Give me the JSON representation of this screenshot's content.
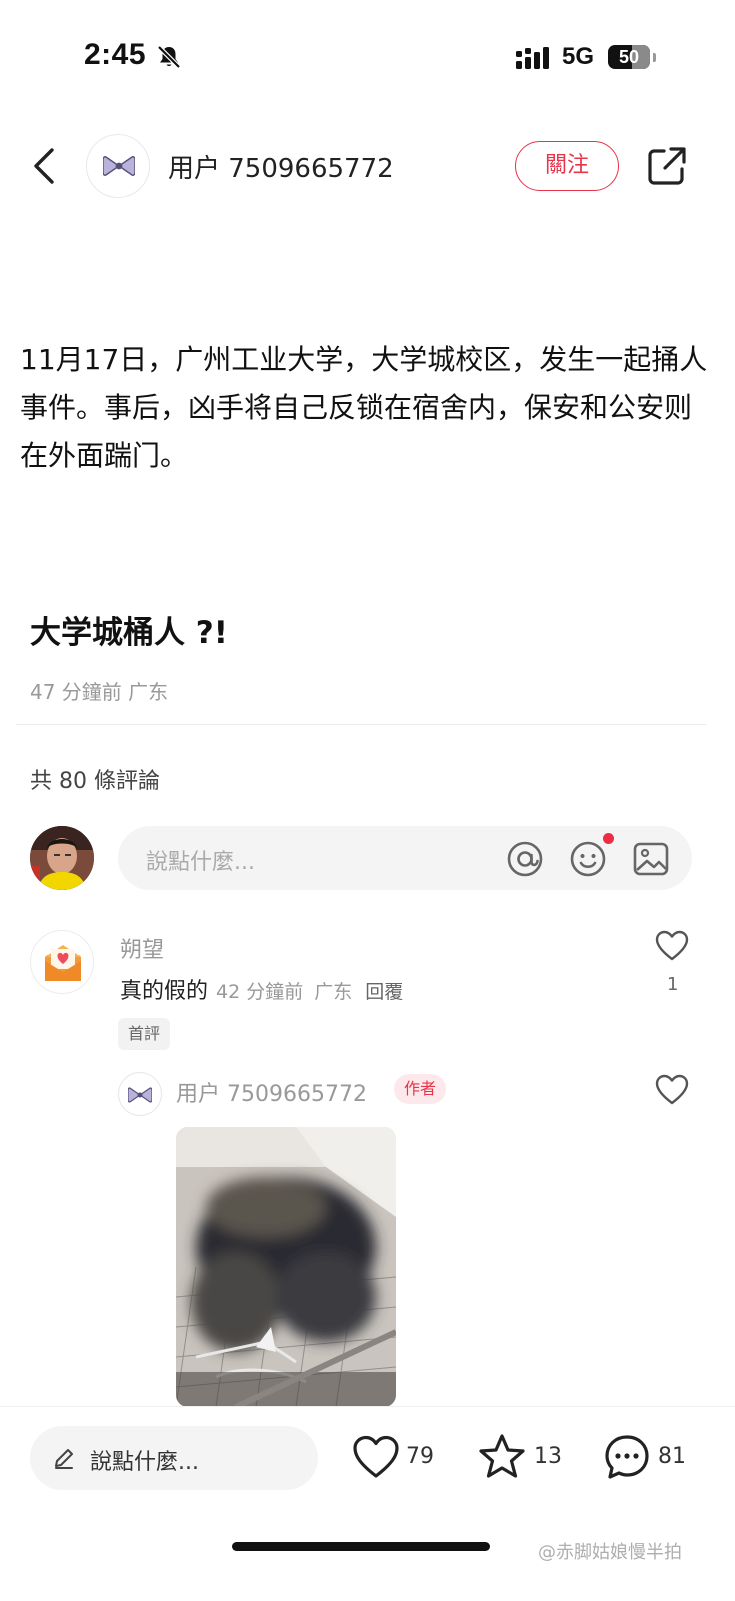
{
  "status_bar": {
    "time": "2:45",
    "network": "5G",
    "battery": "50",
    "icons": [
      "bell-muted-icon",
      "signal-icon",
      "battery-icon"
    ]
  },
  "header": {
    "author_name": "用户 7509665772",
    "follow_label": "關注",
    "icons": [
      "back-arrow-icon",
      "bow-avatar-icon",
      "share-icon"
    ]
  },
  "post": {
    "body": "11月17日，广州工业大学，大学城校区，发生一起捅人事件。事后，凶手将自己反锁在宿舍内，保安和公安则在外面踹门。",
    "title": "大学城桶人 ?!",
    "time": "47 分鐘前",
    "location": "广东"
  },
  "comments_section": {
    "count_label": "共 80 條評論",
    "input_placeholder": "說點什麼...",
    "input_icons": [
      "at-icon",
      "emoji-icon",
      "image-icon"
    ]
  },
  "comments": [
    {
      "name": "朔望",
      "text": "真的假的",
      "time": "42 分鐘前",
      "location": "广东",
      "reply_label": "回覆",
      "likes": "1",
      "badge": "首評",
      "avatar_icon": "heart-envelope-icon"
    }
  ],
  "reply": {
    "name": "用户 7509665772",
    "badge": "作者",
    "image": "blurred-photo"
  },
  "bottom_bar": {
    "input_label": "說點什麼...",
    "likes": "79",
    "favorites": "13",
    "comments": "81",
    "icons": [
      "pencil-icon",
      "heart-icon",
      "star-icon",
      "comment-bubble-icon"
    ]
  },
  "watermark": "@赤脚姑娘慢半拍",
  "colors": {
    "accent": "#e8344a",
    "muted_text": "#999999",
    "input_bg": "#f4f4f4"
  }
}
